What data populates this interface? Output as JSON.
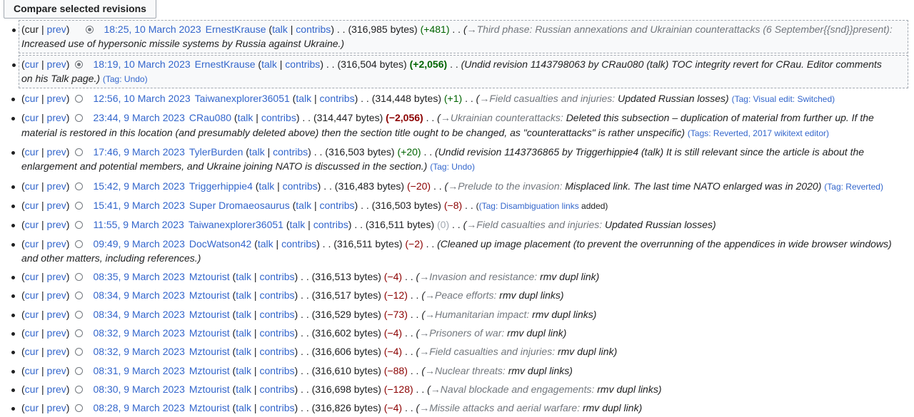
{
  "compare_button": "Compare selected revisions",
  "labels": {
    "cur": "cur",
    "prev": "prev",
    "talk": "talk",
    "contribs": "contribs",
    "dots": ". ."
  },
  "revisions": [
    {
      "date": "18:25, 10 March 2023",
      "user": "ErnestKrause",
      "size": "(316,985 bytes)",
      "delta": "(+481)",
      "delta_type": "pos",
      "section": "→Third phase: Russian annexations and Ukrainian counterattacks (6 September{{snd}}present):",
      "comment": "Increased use of hypersonic missile systems by Russia against Ukraine.)",
      "tags_prefix": "",
      "tags": ""
    },
    {
      "date": "18:19, 10 March 2023",
      "user": "ErnestKrause",
      "size": "(316,504 bytes)",
      "delta": "(+2,056)",
      "delta_type": "pos",
      "section": "",
      "comment": "(Undid revision 1143798063 by CRau080 (talk) TOC integrity revert for CRau. Editor comments on his Talk page.)",
      "tags_prefix": "(Tag:",
      "tags": "Undo)"
    },
    {
      "date": "12:56, 10 March 2023",
      "user": "Taiwanexplorer36051",
      "size": "(314,448 bytes)",
      "delta": "(+1)",
      "delta_type": "pos",
      "section": "→Field casualties and injuries:",
      "comment": "Updated Russian losses)",
      "tags_prefix": "(Tag:",
      "tags": "Visual edit: Switched)"
    },
    {
      "date": "23:44, 9 March 2023",
      "user": "CRau080",
      "size": "(314,447 bytes)",
      "delta": "(−2,056)",
      "delta_type": "neg",
      "section": "→Ukrainian counterattacks:",
      "comment": "Deleted this subsection – duplication of material from further up. If the material is restored in this location (and presumably deleted above) then the section title ought to be changed, as \"counterattacks\" is rather unspecific)",
      "tags_prefix": "(Tags: Reverted,",
      "tags": "2017 wikitext editor)"
    },
    {
      "date": "17:46, 9 March 2023",
      "user": "TylerBurden",
      "size": "(316,503 bytes)",
      "delta": "(+20)",
      "delta_type": "pos",
      "section": "",
      "comment": "(Undid revision 1143736865 by Triggerhippie4 (talk) It is still relevant since the article is about the enlargement and potential members, and Ukraine joining NATO is discussed in the section.)",
      "tags_prefix": "(Tag:",
      "tags": "Undo)"
    },
    {
      "date": "15:42, 9 March 2023",
      "user": "Triggerhippie4",
      "size": "(316,483 bytes)",
      "delta": "(−20)",
      "delta_type": "neg",
      "section": "→Prelude to the invasion:",
      "comment": "Misplaced link. The last time NATO enlarged was in 2020)",
      "tags_prefix": "(Tag: Reverted)",
      "tags": ""
    },
    {
      "date": "15:41, 9 March 2023",
      "user": "Super Dromaeosaurus",
      "size": "(316,503 bytes)",
      "delta": "(−8)",
      "delta_type": "neg",
      "section": "",
      "comment": "",
      "tags_prefix": "(Tag:",
      "tags": "Disambiguation links",
      "tags_suffix": "added)"
    },
    {
      "date": "11:55, 9 March 2023",
      "user": "Taiwanexplorer36051",
      "size": "(316,511 bytes)",
      "delta": "(0)",
      "delta_type": "null",
      "section": "→Field casualties and injuries:",
      "comment": "Updated Russian losses)",
      "tags_prefix": "",
      "tags": ""
    },
    {
      "date": "09:49, 9 March 2023",
      "user": "DocWatson42",
      "size": "(316,511 bytes)",
      "delta": "(−2)",
      "delta_type": "neg",
      "section": "",
      "comment": "(Cleaned up image placement (to prevent the overrunning of the appendices in wide browser windows) and other matters, including references.)",
      "tags_prefix": "",
      "tags": ""
    },
    {
      "date": "08:35, 9 March 2023",
      "user": "Mztourist",
      "size": "(316,513 bytes)",
      "delta": "(−4)",
      "delta_type": "neg",
      "section": "→Invasion and resistance:",
      "comment": "rmv dupl link)",
      "tags_prefix": "",
      "tags": ""
    },
    {
      "date": "08:34, 9 March 2023",
      "user": "Mztourist",
      "size": "(316,517 bytes)",
      "delta": "(−12)",
      "delta_type": "neg",
      "section": "→Peace efforts:",
      "comment": "rmv dupl links)",
      "tags_prefix": "",
      "tags": ""
    },
    {
      "date": "08:34, 9 March 2023",
      "user": "Mztourist",
      "size": "(316,529 bytes)",
      "delta": "(−73)",
      "delta_type": "neg",
      "section": "→Humanitarian impact:",
      "comment": "rmv dupl links)",
      "tags_prefix": "",
      "tags": ""
    },
    {
      "date": "08:32, 9 March 2023",
      "user": "Mztourist",
      "size": "(316,602 bytes)",
      "delta": "(−4)",
      "delta_type": "neg",
      "section": "→Prisoners of war:",
      "comment": "rmv dupl link)",
      "tags_prefix": "",
      "tags": ""
    },
    {
      "date": "08:32, 9 March 2023",
      "user": "Mztourist",
      "size": "(316,606 bytes)",
      "delta": "(−4)",
      "delta_type": "neg",
      "section": "→Field casualties and injuries:",
      "comment": "rmv dupl link)",
      "tags_prefix": "",
      "tags": ""
    },
    {
      "date": "08:31, 9 March 2023",
      "user": "Mztourist",
      "size": "(316,610 bytes)",
      "delta": "(−88)",
      "delta_type": "neg",
      "section": "→Nuclear threats:",
      "comment": "rmv dupl links)",
      "tags_prefix": "",
      "tags": ""
    },
    {
      "date": "08:30, 9 March 2023",
      "user": "Mztourist",
      "size": "(316,698 bytes)",
      "delta": "(−128)",
      "delta_type": "neg",
      "section": "→Naval blockade and engagements:",
      "comment": "rmv dupl links)",
      "tags_prefix": "",
      "tags": ""
    },
    {
      "date": "08:28, 9 March 2023",
      "user": "Mztourist",
      "size": "(316,826 bytes)",
      "delta": "(−4)",
      "delta_type": "neg",
      "section": "→Missile attacks and aerial warfare:",
      "comment": "rmv dupl link)",
      "tags_prefix": "",
      "tags": ""
    }
  ]
}
